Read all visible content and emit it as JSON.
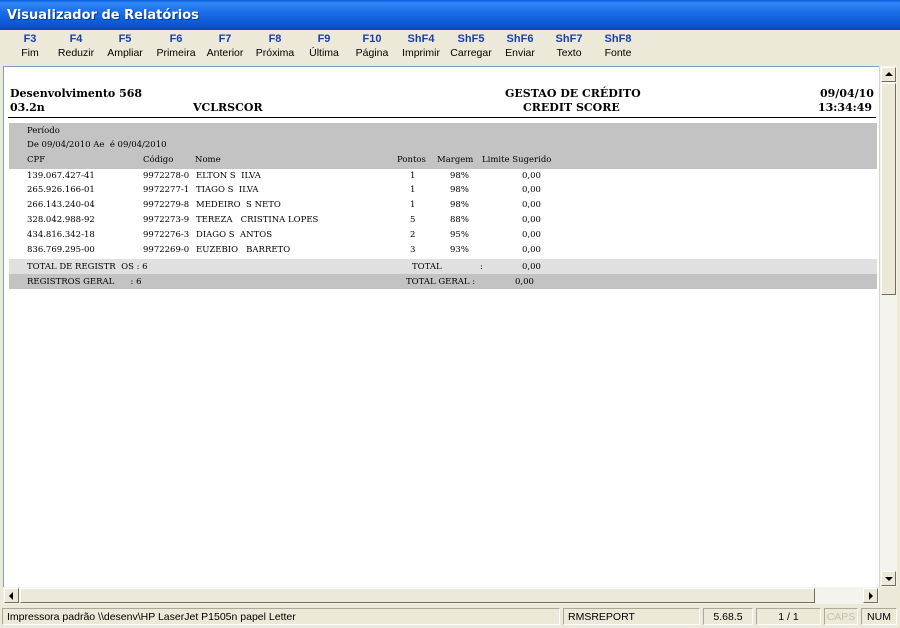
{
  "window": {
    "title": "Visualizador de Relatórios"
  },
  "toolbar": [
    {
      "key": "F3",
      "label": "Fim"
    },
    {
      "key": "F4",
      "label": "Reduzir"
    },
    {
      "key": "F5",
      "label": "Ampliar"
    },
    {
      "key": "F6",
      "label": "Primeira"
    },
    {
      "key": "F7",
      "label": "Anterior"
    },
    {
      "key": "F8",
      "label": "Próxima"
    },
    {
      "key": "F9",
      "label": "Última"
    },
    {
      "key": "F10",
      "label": "Página"
    },
    {
      "key": "ShF4",
      "label": "Imprimir"
    },
    {
      "key": "ShF5",
      "label": "Carregar"
    },
    {
      "key": "ShF6",
      "label": "Enviar"
    },
    {
      "key": "ShF7",
      "label": "Texto"
    },
    {
      "key": "ShF8",
      "label": "Fonte"
    }
  ],
  "report": {
    "header": {
      "company": "Desenvolvimento 568",
      "code": "03.2n",
      "program": "VCLRSCOR",
      "title": "GESTAO DE CRÉDITO",
      "subtitle": "CREDIT SCORE",
      "date": "09/04/10",
      "time": "13:34:49"
    },
    "period_label": "Período",
    "period_value": "De 09/04/2010 Ae  é 09/04/2010",
    "columns": {
      "cpf": "CPF",
      "codigo": "Código",
      "nome": "Nome",
      "pontos": "Pontos",
      "margem": "Margem",
      "limite": "Limite Sugerido"
    },
    "rows": [
      {
        "cpf": "139.067.427-41",
        "codigo": "9972278-0",
        "nome": "ELTON S  ILVA",
        "pontos": "1",
        "margem": "98%",
        "limite": "0,00"
      },
      {
        "cpf": "265.926.166-01",
        "codigo": "9972277-1",
        "nome": "TIAGO S  ILVA",
        "pontos": "1",
        "margem": "98%",
        "limite": "0,00"
      },
      {
        "cpf": "266.143.240-04",
        "codigo": "9972279-8",
        "nome": "MEDEIRO  S NETO",
        "pontos": "1",
        "margem": "98%",
        "limite": "0,00"
      },
      {
        "cpf": "328.042.988-92",
        "codigo": "9972273-9",
        "nome": "TEREZA   CRISTINA LOPES",
        "pontos": "5",
        "margem": "88%",
        "limite": "0,00"
      },
      {
        "cpf": "434.816.342-18",
        "codigo": "9972276-3",
        "nome": "DIAGO S  ANTOS",
        "pontos": "2",
        "margem": "95%",
        "limite": "0,00"
      },
      {
        "cpf": "836.769.295-00",
        "codigo": "9972269-0",
        "nome": "EUZEBIO   BARRETO",
        "pontos": "3",
        "margem": "93%",
        "limite": "0,00"
      }
    ],
    "total_registros": "TOTAL DE REGISTR  OS : 6",
    "total_label": "TOTAL",
    "total_sep": ":",
    "total_value": "0,00",
    "registros_geral": "REGISTROS GERAL      : 6",
    "total_geral_label": "TOTAL GERAL :",
    "total_geral_value": "0,00"
  },
  "statusbar": {
    "printer": "Impressora padrão \\\\desenv\\HP LaserJet P1505n papel Letter",
    "report": "RMSREPORT",
    "version": "5.68.5",
    "page": "1 / 1",
    "caps": "CAPS",
    "num": "NUM"
  }
}
